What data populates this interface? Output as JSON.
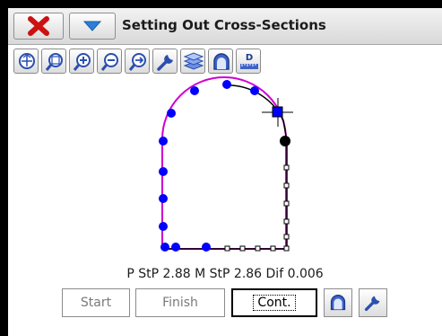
{
  "window": {
    "title": "Setting Out Cross-Sections",
    "close_icon": "close-x-icon",
    "menu_icon": "chevron-down-icon"
  },
  "toolbar": {
    "tools": [
      "zoom-extents-icon",
      "zoom-window-icon",
      "zoom-in-icon",
      "zoom-out-icon",
      "zoom-previous-icon",
      "settings-wrench-icon",
      "layers-icon",
      "tunnel-profile-icon",
      "dimension-ruler-icon"
    ],
    "dimension_label": "D"
  },
  "readout": {
    "text": "P StP 2.88 M StP 2.86 Dif 0.006"
  },
  "buttons": {
    "start": "Start",
    "finish": "Finish",
    "cont": "Cont."
  },
  "colors": {
    "design_profile": "#d000d0",
    "points": "#0000ff",
    "scan": "#000000",
    "x_red": "#cc1111",
    "chevron_blue": "#2a7fd6"
  }
}
